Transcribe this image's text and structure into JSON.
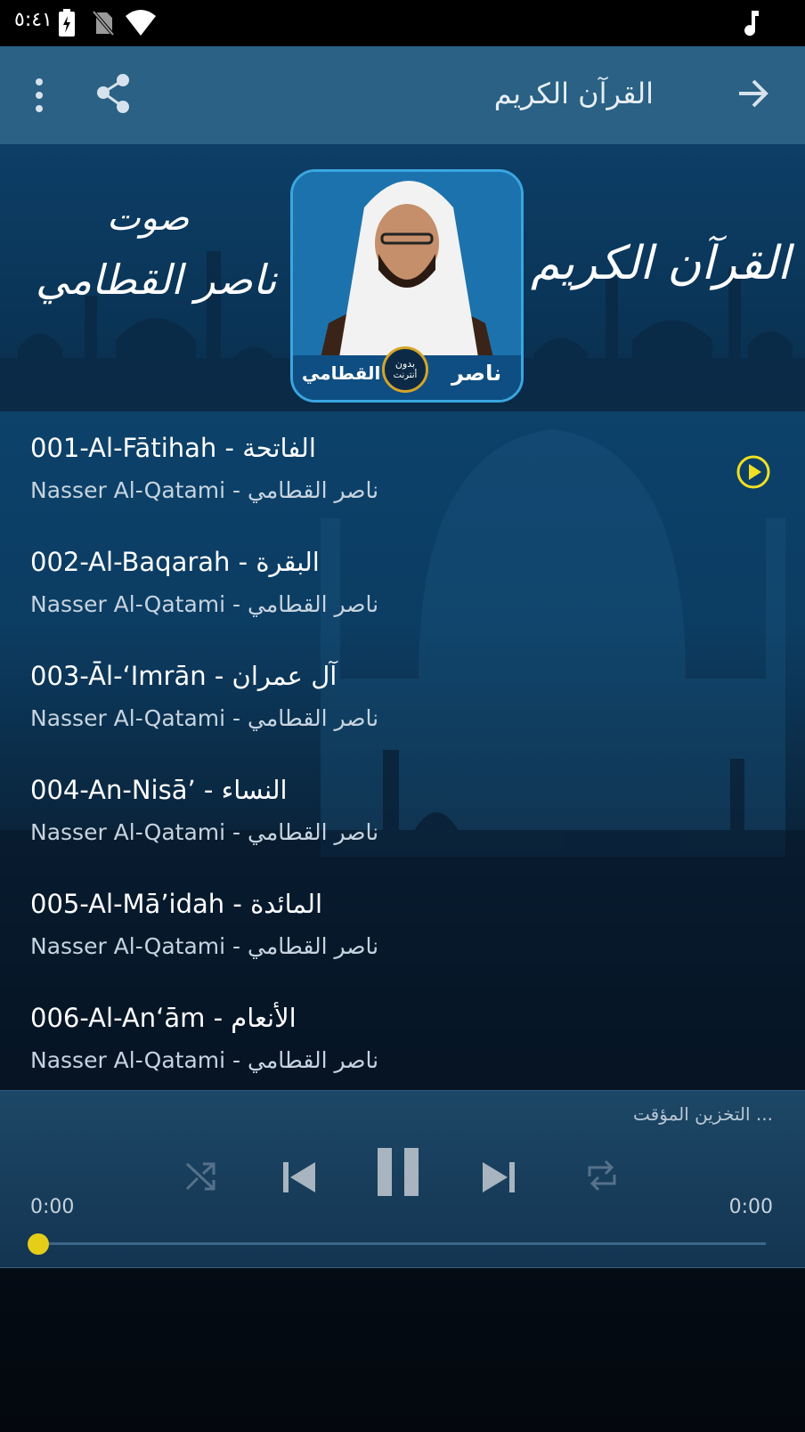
{
  "status_bar": {
    "time": "٥:٤١"
  },
  "app_bar": {
    "title": "القرآن الكريم"
  },
  "banner": {
    "left_text_top": "صوت",
    "left_text_bottom": "ناصر القطامي",
    "right_text": "القرآن الكريم",
    "portrait_name_right": "ناصر",
    "portrait_name_left": "القطامي",
    "seal_line1": "بدون",
    "seal_line2": "أنترنت"
  },
  "tracks": [
    {
      "title": "001-Al-Fātihah - الفاتحة",
      "subtitle": "Nasser Al-Qatami - ناصر القطامي",
      "playing": true
    },
    {
      "title": "002-Al-Baqarah - البقرة",
      "subtitle": "Nasser Al-Qatami - ناصر القطامي",
      "playing": false
    },
    {
      "title": "003-Āl-‘Imrān - آل عمران",
      "subtitle": "Nasser Al-Qatami - ناصر القطامي",
      "playing": false
    },
    {
      "title": "004-An-Nisā’ - النساء",
      "subtitle": "Nasser Al-Qatami - ناصر القطامي",
      "playing": false
    },
    {
      "title": "005-Al-Mā’idah - المائدة",
      "subtitle": "Nasser Al-Qatami - ناصر القطامي",
      "playing": false
    },
    {
      "title": "006-Al-An‘ām - الأنعام",
      "subtitle": "Nasser Al-Qatami - ناصر القطامي",
      "playing": false
    }
  ],
  "player": {
    "buffering_text": "التخزين المؤقت ...",
    "elapsed": "0:00",
    "duration": "0:00",
    "progress": 0
  },
  "colors": {
    "accent_play": "#f0e022",
    "seek_thumb": "#e6cd18",
    "app_bar": "#2a6184"
  },
  "icons": [
    "music-note-icon",
    "battery-charging-icon",
    "no-sim-icon",
    "wifi-icon",
    "back-arrow-icon",
    "share-icon",
    "more-vert-icon",
    "play-circle-icon",
    "shuffle-icon",
    "skip-previous-icon",
    "pause-icon",
    "skip-next-icon",
    "repeat-icon"
  ]
}
